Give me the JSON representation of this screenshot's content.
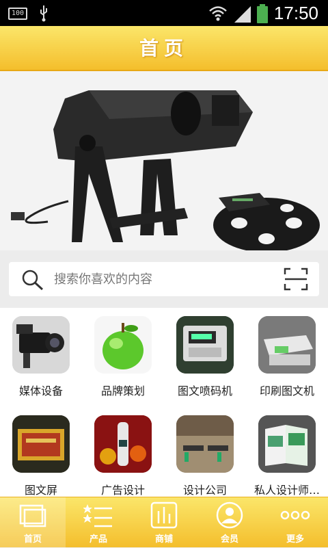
{
  "status": {
    "battery_small": "100",
    "time": "17:50"
  },
  "header": {
    "title": "首页"
  },
  "banner": {
    "slide_count": 4,
    "active_index": 1
  },
  "search": {
    "placeholder": "搜索你喜欢的内容"
  },
  "grid": {
    "items": [
      {
        "label": "媒体设备",
        "icon": "video-camera-image"
      },
      {
        "label": "品牌策划",
        "icon": "green-apple-image"
      },
      {
        "label": "图文喷码机",
        "icon": "inkjet-printer-image"
      },
      {
        "label": "印刷图文机",
        "icon": "printing-machine-image"
      },
      {
        "label": "图文屏",
        "icon": "display-screen-image"
      },
      {
        "label": "广告设计",
        "icon": "advertising-poster-image"
      },
      {
        "label": "设计公司",
        "icon": "office-interior-image"
      },
      {
        "label": "私人设计师…",
        "icon": "brochure-image"
      }
    ]
  },
  "tabbar": {
    "items": [
      {
        "label": "首页",
        "icon": "home-icon",
        "active": true
      },
      {
        "label": "产品",
        "icon": "list-icon",
        "active": false
      },
      {
        "label": "商铺",
        "icon": "store-icon",
        "active": false
      },
      {
        "label": "会员",
        "icon": "member-icon",
        "active": false
      },
      {
        "label": "更多",
        "icon": "more-icon",
        "active": false
      }
    ]
  },
  "colors": {
    "accent_top": "#fbe66a",
    "accent_bottom": "#f4be2c",
    "status_bar": "#000000"
  }
}
